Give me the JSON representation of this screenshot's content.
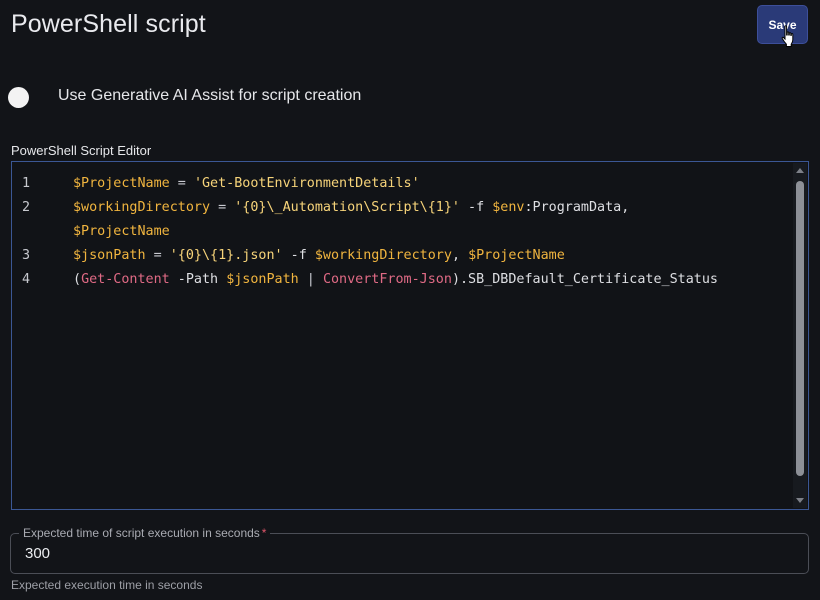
{
  "header": {
    "title": "PowerShell script",
    "save_label": "Save"
  },
  "ai_assist": {
    "label": "Use Generative AI Assist for script creation",
    "enabled": false
  },
  "editor": {
    "label": "PowerShell Script Editor",
    "lines": [
      {
        "number": "1",
        "tokens": [
          {
            "t": "$ProjectName",
            "c": "var"
          },
          {
            "t": " = ",
            "c": "op"
          },
          {
            "t": "'Get-BootEnvironmentDetails'",
            "c": "str"
          }
        ]
      },
      {
        "number": "2",
        "tokens": [
          {
            "t": "$workingDirectory",
            "c": "var"
          },
          {
            "t": " = ",
            "c": "op"
          },
          {
            "t": "'{0}\\_Automation\\Script\\{1}'",
            "c": "str"
          },
          {
            "t": " -f ",
            "c": "plain"
          },
          {
            "t": "$env",
            "c": "var"
          },
          {
            "t": ":ProgramData,",
            "c": "plain"
          }
        ]
      },
      {
        "number": "",
        "tokens": [
          {
            "t": "$ProjectName",
            "c": "var"
          }
        ]
      },
      {
        "number": "3",
        "tokens": [
          {
            "t": "$jsonPath",
            "c": "var"
          },
          {
            "t": " = ",
            "c": "op"
          },
          {
            "t": "'{0}\\{1}.json'",
            "c": "str"
          },
          {
            "t": " -f ",
            "c": "plain"
          },
          {
            "t": "$workingDirectory",
            "c": "var"
          },
          {
            "t": ", ",
            "c": "plain"
          },
          {
            "t": "$ProjectName",
            "c": "var"
          }
        ]
      },
      {
        "number": "4",
        "tokens": [
          {
            "t": "(",
            "c": "plain"
          },
          {
            "t": "Get-Content",
            "c": "cmd"
          },
          {
            "t": " -Path ",
            "c": "plain"
          },
          {
            "t": "$jsonPath",
            "c": "var"
          },
          {
            "t": " | ",
            "c": "op"
          },
          {
            "t": "ConvertFrom-Json",
            "c": "cmd"
          },
          {
            "t": ").SB_DBDefault_Certificate_Status",
            "c": "plain"
          }
        ]
      }
    ]
  },
  "timeout_field": {
    "label": "Expected time of script execution in seconds",
    "required_mark": "*",
    "value": "300",
    "helper": "Expected execution time in seconds"
  },
  "colors": {
    "accent_button": "#2a3a78",
    "editor_border": "#3b5794",
    "variable": "#f1b53f",
    "string": "#f7d47a",
    "cmdlet": "#e06a85",
    "required": "#e0566a"
  }
}
